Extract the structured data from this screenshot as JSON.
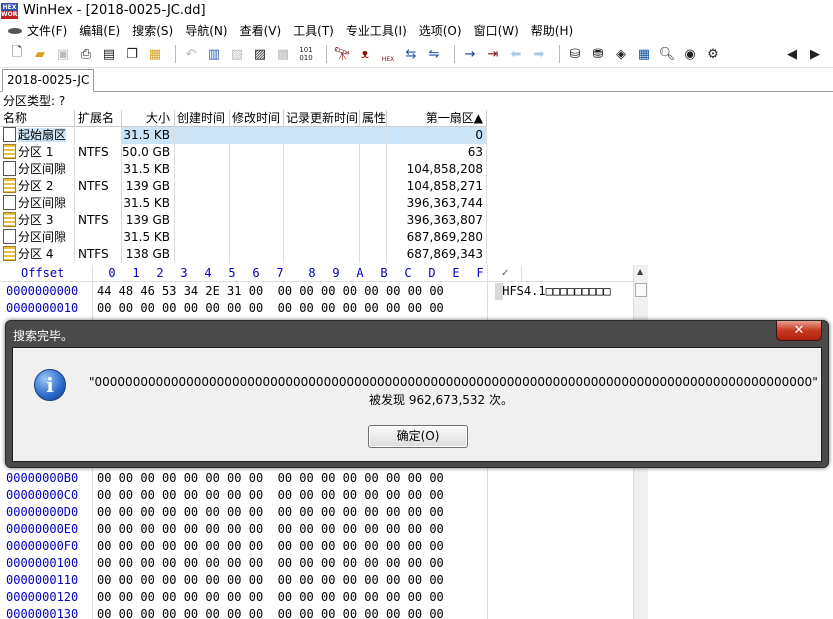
{
  "window": {
    "title": "WinHex - [2018-0025-JC.dd]",
    "logo_text": "HEX WORKS"
  },
  "menu": [
    {
      "label": "文件(F)"
    },
    {
      "label": "编辑(E)"
    },
    {
      "label": "搜索(S)"
    },
    {
      "label": "导航(N)"
    },
    {
      "label": "查看(V)"
    },
    {
      "label": "工具(T)"
    },
    {
      "label": "专业工具(I)"
    },
    {
      "label": "选项(O)"
    },
    {
      "label": "窗口(W)"
    },
    {
      "label": "帮助(H)"
    }
  ],
  "toolbar": {
    "icons": [
      "new-file-icon",
      "open-file-icon",
      "save-icon",
      "print-icon",
      "properties-icon",
      "copy-icon",
      "undo-icon",
      "cut-icon",
      "paste-icon",
      "paste-special-icon",
      "copy-block-icon",
      "find-icon",
      "find-text-icon",
      "find-hex-icon",
      "replace-text-icon",
      "replace-hex-icon",
      "goto-offset-icon",
      "goto-sector-icon",
      "back-icon",
      "forward-icon",
      "open-disk-icon",
      "clone-disk-icon",
      "ram-editor-icon",
      "calculator-icon",
      "hash-icon",
      "analysis-icon",
      "settings-icon",
      "scroll-left-icon",
      "scroll-right-icon"
    ],
    "hex_badge": "HEX",
    "goto_binary": "101 010"
  },
  "tab": {
    "label": "2018-0025-JC"
  },
  "partition_type": {
    "label": "分区类型: ?"
  },
  "dirlist": {
    "columns": [
      "名称",
      "扩展名",
      "大小",
      "创建时间",
      "修改时间",
      "记录更新时间",
      "属性",
      "第一扇区▲"
    ],
    "rows": [
      {
        "name": "起始扇区",
        "ext": "",
        "size": "31.5 KB",
        "sector": "0",
        "icon": "file",
        "selected": true
      },
      {
        "name": "分区 1",
        "ext": "NTFS",
        "size": "50.0 GB",
        "sector": "63",
        "icon": "part"
      },
      {
        "name": "分区间隙",
        "ext": "",
        "size": "31.5 KB",
        "sector": "104,858,208",
        "icon": "file"
      },
      {
        "name": "分区 2",
        "ext": "NTFS",
        "size": "139 GB",
        "sector": "104,858,271",
        "icon": "part"
      },
      {
        "name": "分区间隙",
        "ext": "",
        "size": "31.5 KB",
        "sector": "396,363,744",
        "icon": "file"
      },
      {
        "name": "分区 3",
        "ext": "NTFS",
        "size": "139 GB",
        "sector": "396,363,807",
        "icon": "part"
      },
      {
        "name": "分区间隙",
        "ext": "",
        "size": "31.5 KB",
        "sector": "687,869,280",
        "icon": "file"
      },
      {
        "name": "分区 4",
        "ext": "NTFS",
        "size": "138 GB",
        "sector": "687,869,343",
        "icon": "part"
      }
    ]
  },
  "hex": {
    "offset_label": "Offset",
    "columns": [
      "0",
      "1",
      "2",
      "3",
      "4",
      "5",
      "6",
      "7",
      "8",
      "9",
      "A",
      "B",
      "C",
      "D",
      "E",
      "F"
    ],
    "rows": [
      {
        "offset": "0000000000",
        "bytes": "44 48 46 53 34 2E 31 00  00 00 00 00 00 00 00 00",
        "text": "DHFS4.1□□□□□□□□□"
      },
      {
        "offset": "0000000010",
        "bytes": "00 00 00 00 00 00 00 00  00 00 00 00 00 00 00 00",
        "text": ""
      },
      {
        "offset": "00000000B0",
        "bytes": "00 00 00 00 00 00 00 00  00 00 00 00 00 00 00 00",
        "text": ""
      },
      {
        "offset": "00000000C0",
        "bytes": "00 00 00 00 00 00 00 00  00 00 00 00 00 00 00 00",
        "text": ""
      },
      {
        "offset": "00000000D0",
        "bytes": "00 00 00 00 00 00 00 00  00 00 00 00 00 00 00 00",
        "text": ""
      },
      {
        "offset": "00000000E0",
        "bytes": "00 00 00 00 00 00 00 00  00 00 00 00 00 00 00 00",
        "text": ""
      },
      {
        "offset": "00000000F0",
        "bytes": "00 00 00 00 00 00 00 00  00 00 00 00 00 00 00 00",
        "text": ""
      },
      {
        "offset": "0000000100",
        "bytes": "00 00 00 00 00 00 00 00  00 00 00 00 00 00 00 00",
        "text": ""
      },
      {
        "offset": "0000000110",
        "bytes": "00 00 00 00 00 00 00 00  00 00 00 00 00 00 00 00",
        "text": ""
      },
      {
        "offset": "0000000120",
        "bytes": "00 00 00 00 00 00 00 00  00 00 00 00 00 00 00 00",
        "text": ""
      },
      {
        "offset": "0000000130",
        "bytes": "00 00 00 00 00 00 00 00  00 00 00 00 00 00 00 00",
        "text": ""
      }
    ]
  },
  "dialog": {
    "title": "搜索完毕。",
    "close_label": "✕",
    "message_line1": "\"0000000000000000000000000000000000000000000000000000000000000000000000000000000000000000000000\"",
    "message_line2": "被发现 962,673,532 次。",
    "ok_label": "确定(O)"
  }
}
